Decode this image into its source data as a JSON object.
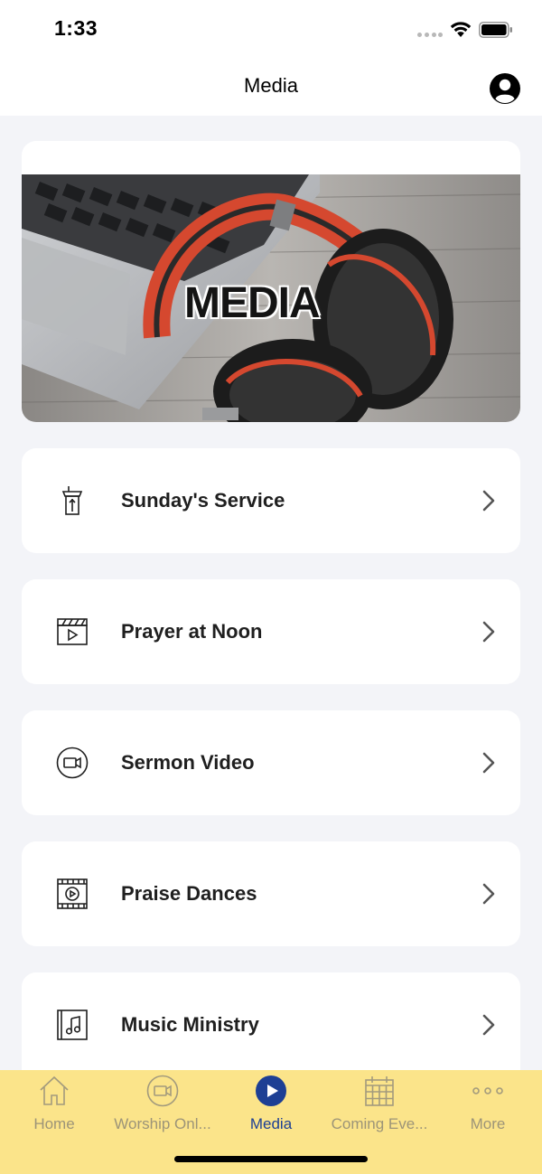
{
  "status_bar": {
    "time": "1:33"
  },
  "header": {
    "title": "Media",
    "profile_icon": "person-circle-icon"
  },
  "banner": {
    "label": "MEDIA",
    "image": "laptop-headphones-photo"
  },
  "menu": [
    {
      "label": "Sunday's Service",
      "icon": "pulpit-icon"
    },
    {
      "label": "Prayer at Noon",
      "icon": "clapperboard-icon"
    },
    {
      "label": "Sermon Video",
      "icon": "video-camera-circle-icon"
    },
    {
      "label": "Praise Dances",
      "icon": "film-play-icon"
    },
    {
      "label": "Music Ministry",
      "icon": "music-album-icon"
    }
  ],
  "tabbar": {
    "active_index": 2,
    "tabs": [
      {
        "label": "Home",
        "icon": "house-icon"
      },
      {
        "label": "Worship Onl...",
        "icon": "video-circle-icon"
      },
      {
        "label": "Media",
        "icon": "play-circle-icon"
      },
      {
        "label": "Coming Eve...",
        "icon": "calendar-icon"
      },
      {
        "label": "More",
        "icon": "more-dots-icon"
      }
    ]
  },
  "colors": {
    "background": "#f3f4f8",
    "tabbar_bg": "#fbe48a",
    "active_tab": "#1d3f94",
    "inactive_tab": "#9c9478",
    "headphones_accent": "#d5482f"
  }
}
